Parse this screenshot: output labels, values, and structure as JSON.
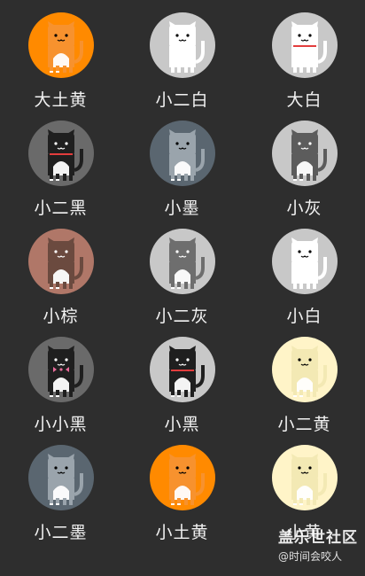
{
  "cats": [
    {
      "name": "大土黄",
      "bg": "#ff8a00",
      "cat": "#f7922e",
      "accent": "#ffffff",
      "collar": "none",
      "dark": false
    },
    {
      "name": "小二白",
      "bg": "#c8c8c8",
      "cat": "#ffffff",
      "accent": "#ffffff",
      "collar": "none",
      "dark": false
    },
    {
      "name": "大白",
      "bg": "#c8c8c8",
      "cat": "#ffffff",
      "accent": "#ffffff",
      "collar": "#e23d3d",
      "dark": false
    },
    {
      "name": "小二黑",
      "bg": "#6a6a6a",
      "cat": "#1f1f1f",
      "accent": "#ffffff",
      "collar": "#e23d3d",
      "dark": true
    },
    {
      "name": "小墨",
      "bg": "#5a6670",
      "cat": "#9aa4ac",
      "accent": "#ffffff",
      "collar": "none",
      "dark": false
    },
    {
      "name": "小灰",
      "bg": "#c8c8c8",
      "cat": "#5c5c5c",
      "accent": "#ffffff",
      "collar": "none",
      "dark": true
    },
    {
      "name": "小棕",
      "bg": "#b07768",
      "cat": "#6b4a3f",
      "accent": "#ffffff",
      "collar": "none",
      "dark": true
    },
    {
      "name": "小二灰",
      "bg": "#c8c8c8",
      "cat": "#6e6e6e",
      "accent": "#ffffff",
      "collar": "none",
      "dark": true
    },
    {
      "name": "小白",
      "bg": "#c8c8c8",
      "cat": "#ffffff",
      "accent": "#ffffff",
      "collar": "none",
      "dark": false
    },
    {
      "name": "小小黑",
      "bg": "#6a6a6a",
      "cat": "#1f1f1f",
      "accent": "#ffffff",
      "collar": "bow",
      "dark": true
    },
    {
      "name": "小黑",
      "bg": "#c8c8c8",
      "cat": "#1f1f1f",
      "accent": "#ffffff",
      "collar": "#e23d3d",
      "dark": true
    },
    {
      "name": "小二黄",
      "bg": "#fff4c8",
      "cat": "#f3e9b4",
      "accent": "#ffffff",
      "collar": "none",
      "dark": false
    },
    {
      "name": "小二墨",
      "bg": "#5a6670",
      "cat": "#9aa4ac",
      "accent": "#ffffff",
      "collar": "none",
      "dark": false
    },
    {
      "name": "小土黄",
      "bg": "#ff8a00",
      "cat": "#f7922e",
      "accent": "#ffffff",
      "collar": "none",
      "dark": false
    },
    {
      "name": "小黄",
      "bg": "#fff4c8",
      "cat": "#f3e9b4",
      "accent": "#ffffff",
      "collar": "none",
      "dark": false
    }
  ],
  "watermark": {
    "logo": "盖乐世社区",
    "user": "@时间会咬人"
  }
}
